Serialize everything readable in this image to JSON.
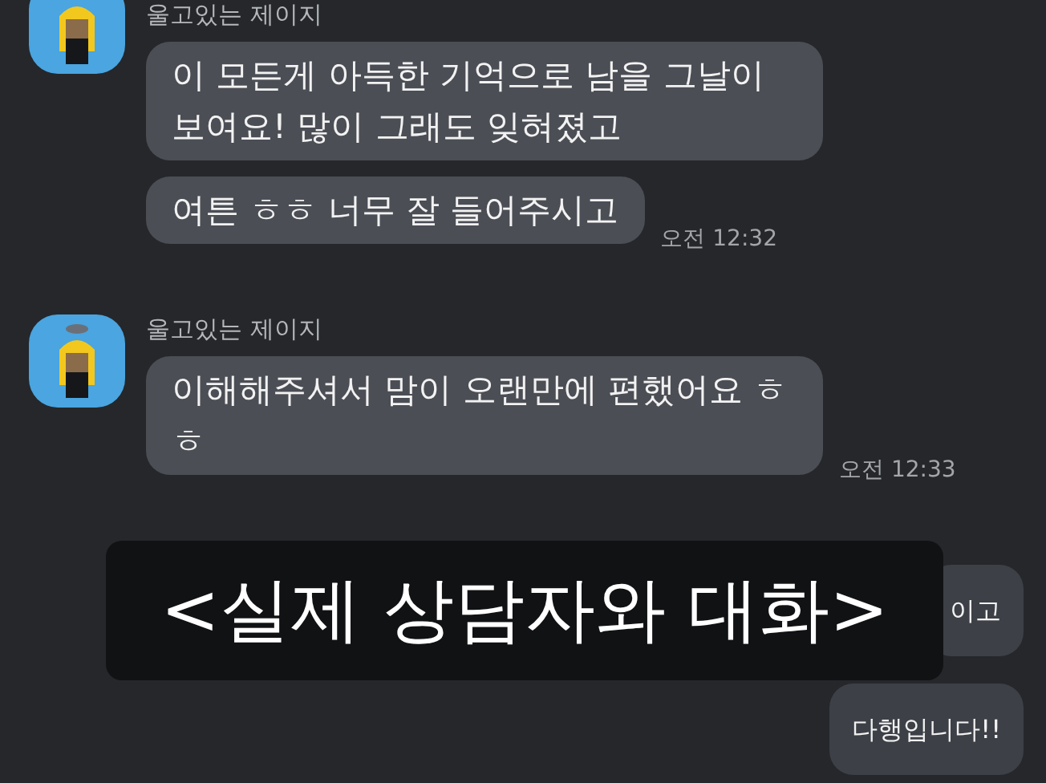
{
  "groups": [
    {
      "kind": "incoming",
      "sender": "울고있는 제이지",
      "bubbles": [
        "이 모든게 아득한 기억으로 남을 그날이 보여요! 많이 그래도 잊혀졌고",
        "여튼 ㅎㅎ 너무 잘 들어주시고"
      ],
      "time": "오전 12:32"
    },
    {
      "kind": "incoming",
      "sender": "울고있는 제이지",
      "bubbles": [
        "이해해주셔서 맘이 오랜만에 편했어요 ㅎㅎ"
      ],
      "time": "오전 12:33"
    },
    {
      "kind": "outgoing",
      "bubbles": [
        "이고",
        "다행입니다!!"
      ]
    }
  ],
  "caption": "<실제 상담자와 대화>"
}
